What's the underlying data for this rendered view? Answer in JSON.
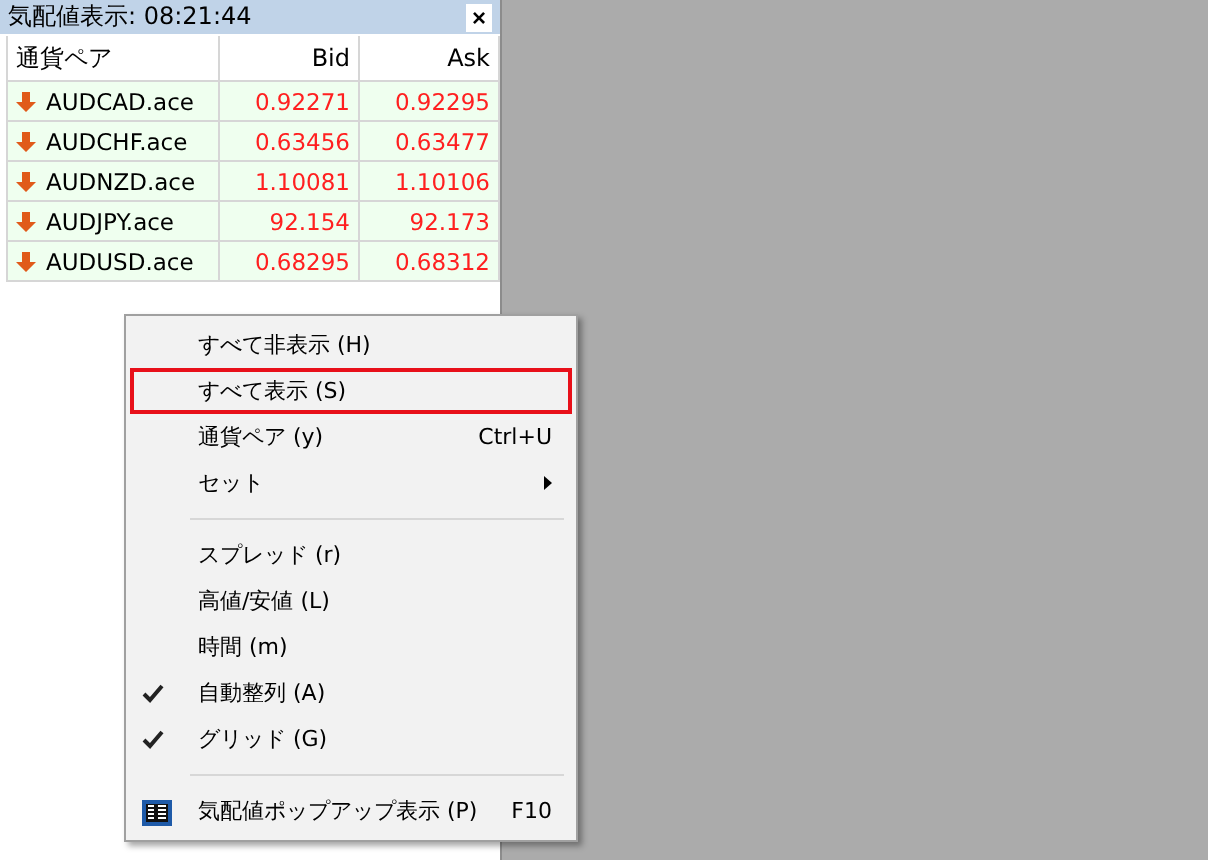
{
  "window": {
    "title": "気配値表示: 08:21:44",
    "close": "×"
  },
  "table": {
    "columns": [
      "通貨ペア",
      "Bid",
      "Ask"
    ],
    "rows": [
      {
        "symbol": "AUDCAD.ace",
        "bid": "0.92271",
        "ask": "0.92295"
      },
      {
        "symbol": "AUDCHF.ace",
        "bid": "0.63456",
        "ask": "0.63477"
      },
      {
        "symbol": "AUDNZD.ace",
        "bid": "1.10081",
        "ask": "1.10106"
      },
      {
        "symbol": "AUDJPY.ace",
        "bid": "92.154",
        "ask": "92.173"
      },
      {
        "symbol": "AUDUSD.ace",
        "bid": "0.68295",
        "ask": "0.68312"
      }
    ]
  },
  "context_menu": {
    "items": [
      {
        "kind": "item",
        "label": "すべて非表示 (H)",
        "selected": false,
        "checked": false
      },
      {
        "kind": "item",
        "label": "すべて表示 (S)",
        "selected": true,
        "checked": false
      },
      {
        "kind": "item",
        "label": "通貨ペア (y)",
        "shortcut": "Ctrl+U",
        "selected": false,
        "checked": false
      },
      {
        "kind": "submenu",
        "label": "セット",
        "selected": false,
        "checked": false
      },
      {
        "kind": "separator"
      },
      {
        "kind": "item",
        "label": "スプレッド (r)",
        "selected": false,
        "checked": false
      },
      {
        "kind": "item",
        "label": "高値/安値 (L)",
        "selected": false,
        "checked": false
      },
      {
        "kind": "item",
        "label": "時間 (m)",
        "selected": false,
        "checked": false
      },
      {
        "kind": "item",
        "label": "自動整列 (A)",
        "selected": false,
        "checked": true
      },
      {
        "kind": "item",
        "label": "グリッド (G)",
        "selected": false,
        "checked": true
      },
      {
        "kind": "separator"
      },
      {
        "kind": "icon_item",
        "label": "気配値ポップアップ表示 (P)",
        "shortcut": "F10",
        "selected": false,
        "checked": false
      }
    ]
  }
}
